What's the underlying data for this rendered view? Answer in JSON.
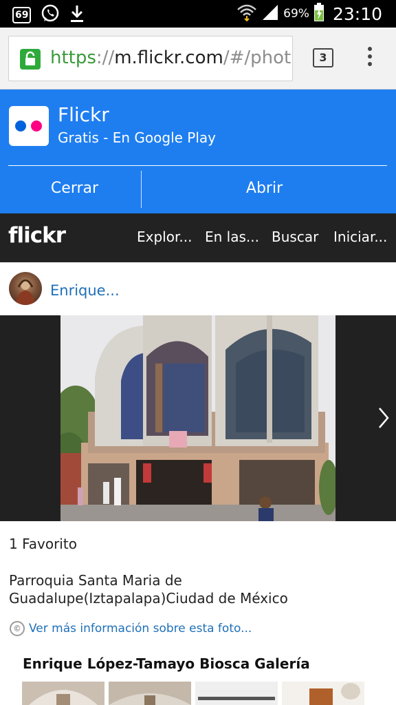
{
  "status_bar": {
    "notif_badge": "69",
    "battery_text": "69%",
    "clock": "23:10"
  },
  "browser": {
    "url_scheme": "https",
    "url_sep": "://",
    "url_host": "m.flickr.com",
    "url_path": "/#/phot",
    "tab_count": "3"
  },
  "app_banner": {
    "app_name": "Flickr",
    "subtitle": "Gratis - En Google Play",
    "close_label": "Cerrar",
    "open_label": "Abrir",
    "background_color": "#1e7ef0",
    "dot_blue": "#0063dc",
    "dot_pink": "#ff0084"
  },
  "flickr_nav": {
    "logo": "flickr",
    "items": [
      {
        "label": "Explor..."
      },
      {
        "label": "En las..."
      },
      {
        "label": "Buscar"
      },
      {
        "label": "Iniciar..."
      }
    ]
  },
  "photo_page": {
    "author": "Enrique...",
    "favorites": "1 Favorito",
    "title": "Parroquia Santa Maria de Guadalupe(Iztapalapa)Ciudad de México",
    "more_info": "Ver más información sobre esta foto...",
    "license_icon": "cc-icon",
    "gallery_title": "Enrique López-Tamayo Biosca Galería",
    "link_color": "#1f6fb8"
  }
}
